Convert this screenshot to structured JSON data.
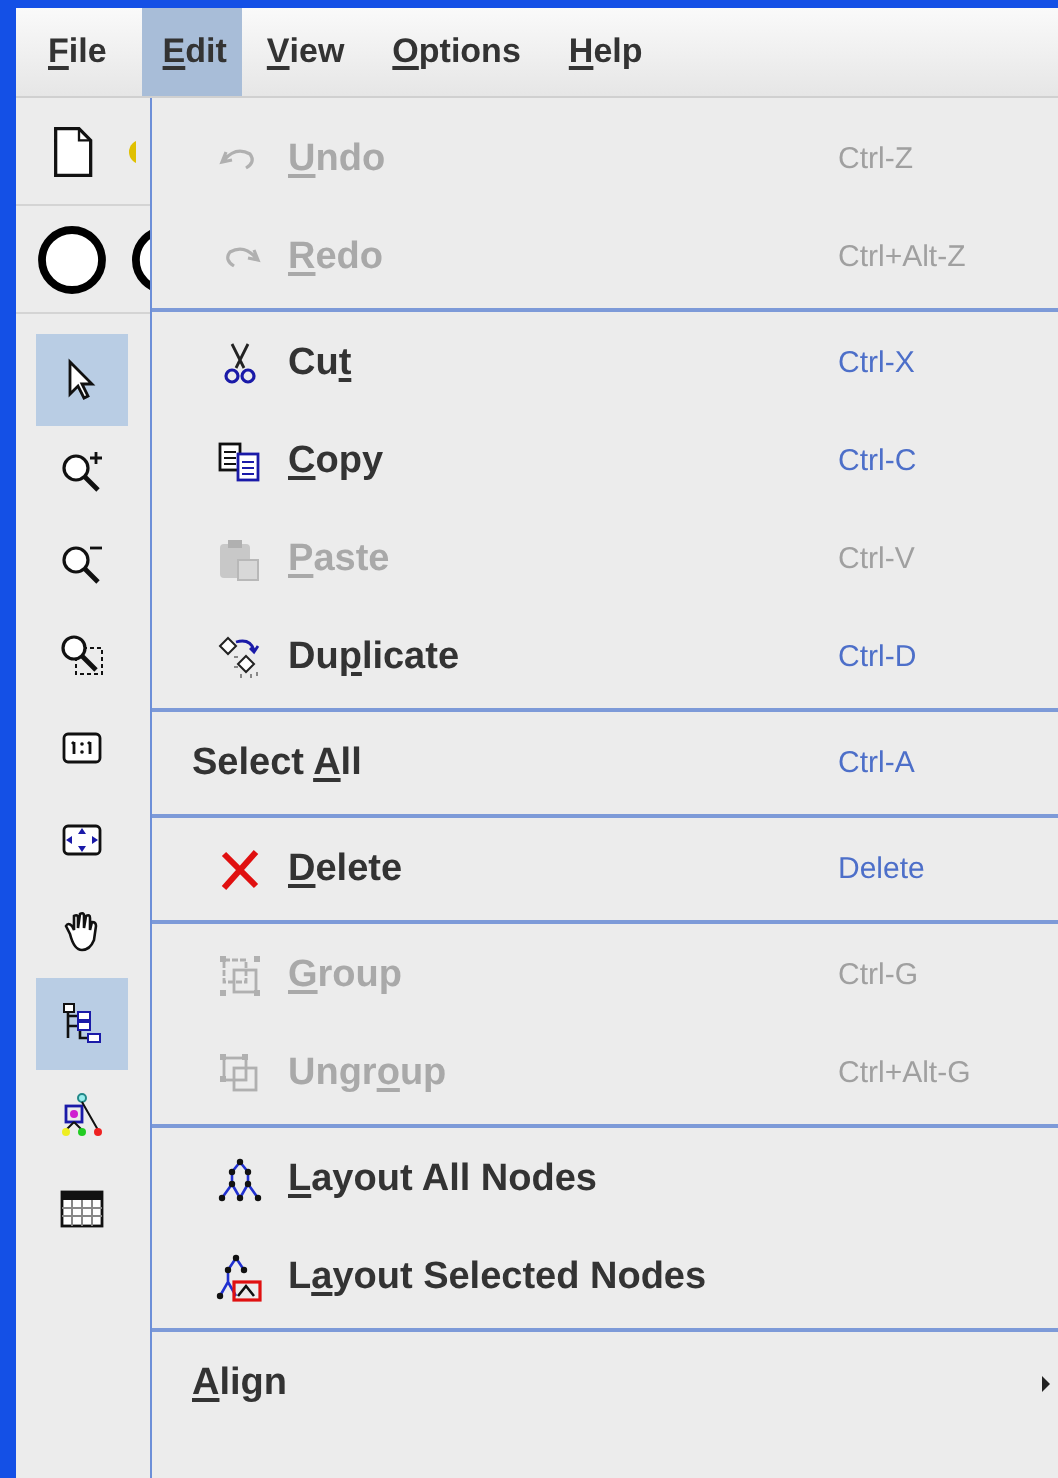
{
  "menubar": [
    {
      "mnemonic": "F",
      "text_after": "ile",
      "selected": false
    },
    {
      "mnemonic": "E",
      "text_after": "dit",
      "selected": true
    },
    {
      "mnemonic": "V",
      "text_after": "iew",
      "selected": false
    },
    {
      "mnemonic": "O",
      "text_after": "ptions",
      "selected": false
    },
    {
      "mnemonic": "H",
      "text_after": "elp",
      "selected": false
    }
  ],
  "tools": [
    {
      "selected": true
    },
    {
      "selected": false
    },
    {
      "selected": false
    },
    {
      "selected": false
    },
    {
      "selected": false
    },
    {
      "selected": false
    },
    {
      "selected": false
    },
    {
      "selected": true
    },
    {
      "selected": false
    },
    {
      "selected": false
    }
  ],
  "edit_menu": {
    "groups": [
      [
        {
          "kind": "item",
          "mnemonic": "U",
          "text_after": "ndo",
          "shortcut": "Ctrl-Z",
          "disabled": true
        },
        {
          "kind": "item",
          "mnemonic": "R",
          "text_after": "edo",
          "shortcut": "Ctrl+Alt-Z",
          "disabled": true
        }
      ],
      [
        {
          "kind": "item",
          "text_before": "Cu",
          "mnemonic": "t",
          "shortcut": "Ctrl-X",
          "disabled": false
        },
        {
          "kind": "item",
          "mnemonic": "C",
          "text_after": "opy",
          "shortcut": "Ctrl-C",
          "disabled": false
        },
        {
          "kind": "item",
          "mnemonic": "P",
          "text_after": "aste",
          "shortcut": "Ctrl-V",
          "disabled": true
        },
        {
          "kind": "item",
          "text_before": "Du",
          "mnemonic": "p",
          "text_after": "licate",
          "shortcut": "Ctrl-D",
          "disabled": false
        }
      ],
      [
        {
          "kind": "item",
          "text_before": "Select ",
          "mnemonic": "A",
          "text_after": "ll",
          "shortcut": "Ctrl-A",
          "disabled": false
        }
      ],
      [
        {
          "kind": "item",
          "mnemonic": "D",
          "text_after": "elete",
          "shortcut": "Delete",
          "disabled": false
        }
      ],
      [
        {
          "kind": "item",
          "mnemonic": "G",
          "text_after": "roup",
          "shortcut": "Ctrl-G",
          "disabled": true
        },
        {
          "kind": "item",
          "text_before": "Ungr",
          "mnemonic": "o",
          "text_after": "up",
          "shortcut": "Ctrl+Alt-G",
          "disabled": true
        }
      ],
      [
        {
          "kind": "item",
          "mnemonic": "L",
          "text_after": "ayout All Nodes",
          "disabled": false
        },
        {
          "kind": "item",
          "text_before": "L",
          "mnemonic": "a",
          "text_after": "yout Selected Nodes",
          "disabled": false
        }
      ],
      [
        {
          "kind": "submenu",
          "mnemonic": "A",
          "text_after": "lign",
          "disabled": false
        }
      ]
    ]
  }
}
